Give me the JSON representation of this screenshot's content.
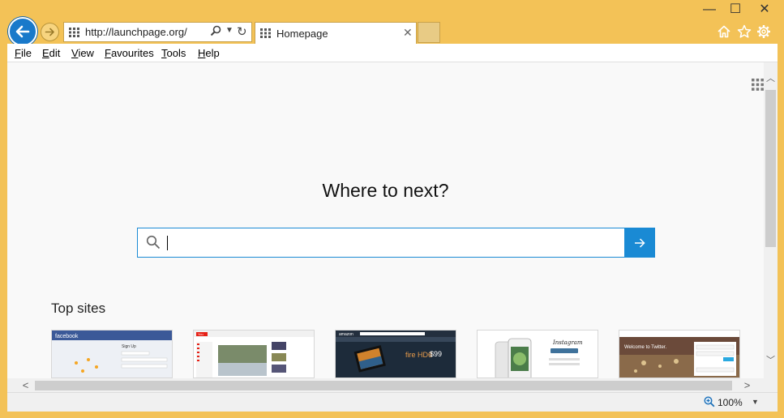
{
  "window": {
    "minimize_glyph": "—",
    "maximize_glyph": "☐",
    "close_glyph": "✕"
  },
  "address_bar": {
    "url": "http://launchpage.org/"
  },
  "tab": {
    "title": "Homepage",
    "close_glyph": "✕"
  },
  "menu": {
    "items": [
      {
        "label": "File",
        "accel": "F",
        "rest": "ile"
      },
      {
        "label": "Edit",
        "accel": "E",
        "rest": "dit"
      },
      {
        "label": "View",
        "accel": "V",
        "rest": "iew"
      },
      {
        "label": "Favourites",
        "accel": "F",
        "rest": "avourites"
      },
      {
        "label": "Tools",
        "accel": "T",
        "rest": "ools"
      },
      {
        "label": "Help",
        "accel": "H",
        "rest": "elp"
      }
    ]
  },
  "page": {
    "headline": "Where to next?",
    "search_value": "",
    "top_sites_label": "Top sites",
    "top_sites": [
      {
        "name": "facebook",
        "header_text": "facebook",
        "signup": "Sign Up"
      },
      {
        "name": "youtube",
        "header_text": "You"
      },
      {
        "name": "amazon",
        "header_text": "amazon",
        "promo": "fire HD6",
        "price": "$99"
      },
      {
        "name": "instagram",
        "header_text": "Instagram"
      },
      {
        "name": "twitter",
        "header_text": "Welcome to Twitter."
      }
    ]
  },
  "status_bar": {
    "zoom": "100%"
  },
  "colors": {
    "frame": "#f3c257",
    "accent": "#1a8ad4",
    "back_button": "#1979ca"
  }
}
